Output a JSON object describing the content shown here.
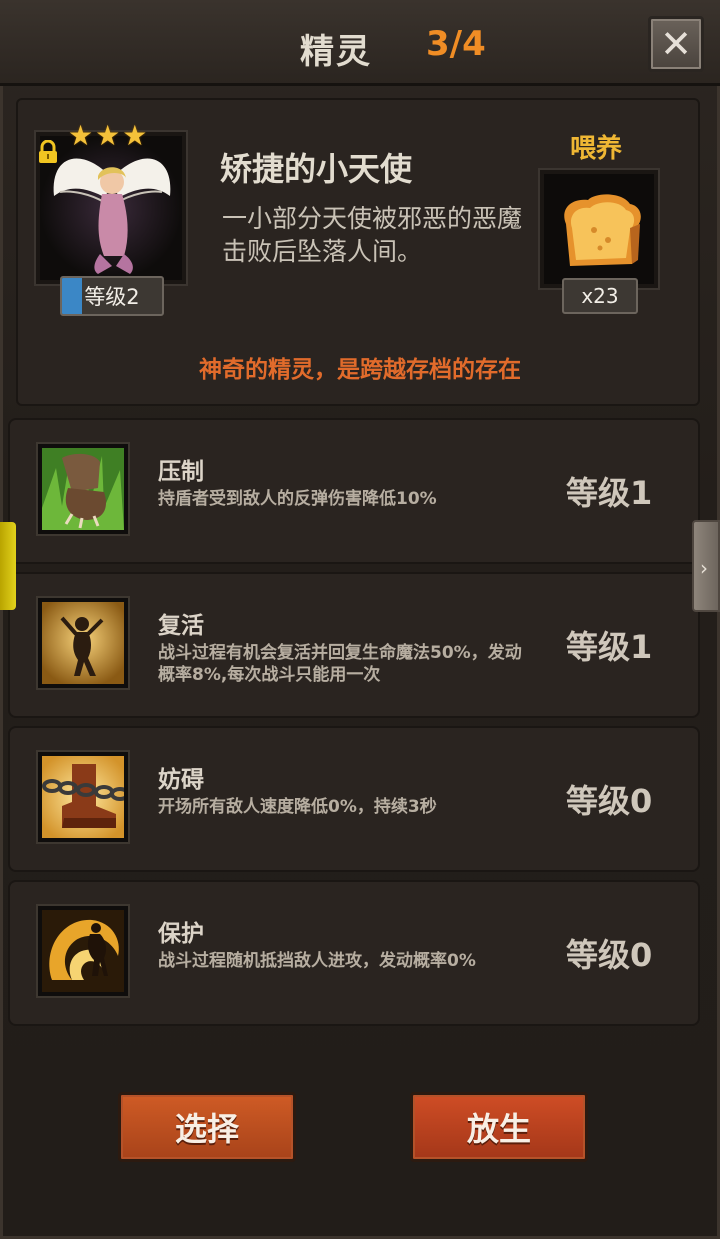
{
  "header": {
    "title": "精灵",
    "count": "3/4",
    "close_icon": "close-icon"
  },
  "pet": {
    "stars": 3,
    "level_label": "等级2",
    "level_progress": 0.2,
    "name": "矫捷的小天使",
    "description": "一小部分天使被邪恶的恶魔击败后坠落人间。",
    "locked": true
  },
  "feed": {
    "label": "喂养",
    "item_icon": "bread-icon",
    "count": "x23"
  },
  "tagline": "神奇的精灵，是跨越存档的存在",
  "skills": [
    {
      "name": "压制",
      "desc": "持盾者受到敌人的反弹伤害降低10%",
      "level": "等级1",
      "icon": "beast-claw-icon"
    },
    {
      "name": "复活",
      "desc": "战斗过程有机会复活并回复生命魔法50%，发动概率8%,每次战斗只能用一次",
      "level": "等级1",
      "icon": "dancing-figure-icon"
    },
    {
      "name": "妨碍",
      "desc": "开场所有敌人速度降低0%，持续3秒",
      "level": "等级0",
      "icon": "chained-boot-icon"
    },
    {
      "name": "保护",
      "desc": "战斗过程随机抵挡敌人进攻，发动概率0%",
      "level": "等级0",
      "icon": "shield-swirl-icon"
    }
  ],
  "buttons": {
    "select": "选择",
    "release": "放生"
  },
  "colors": {
    "accent_orange": "#f08d25",
    "gold": "#efb734",
    "tagline": "#e16b2b",
    "button": "#c0501f"
  }
}
